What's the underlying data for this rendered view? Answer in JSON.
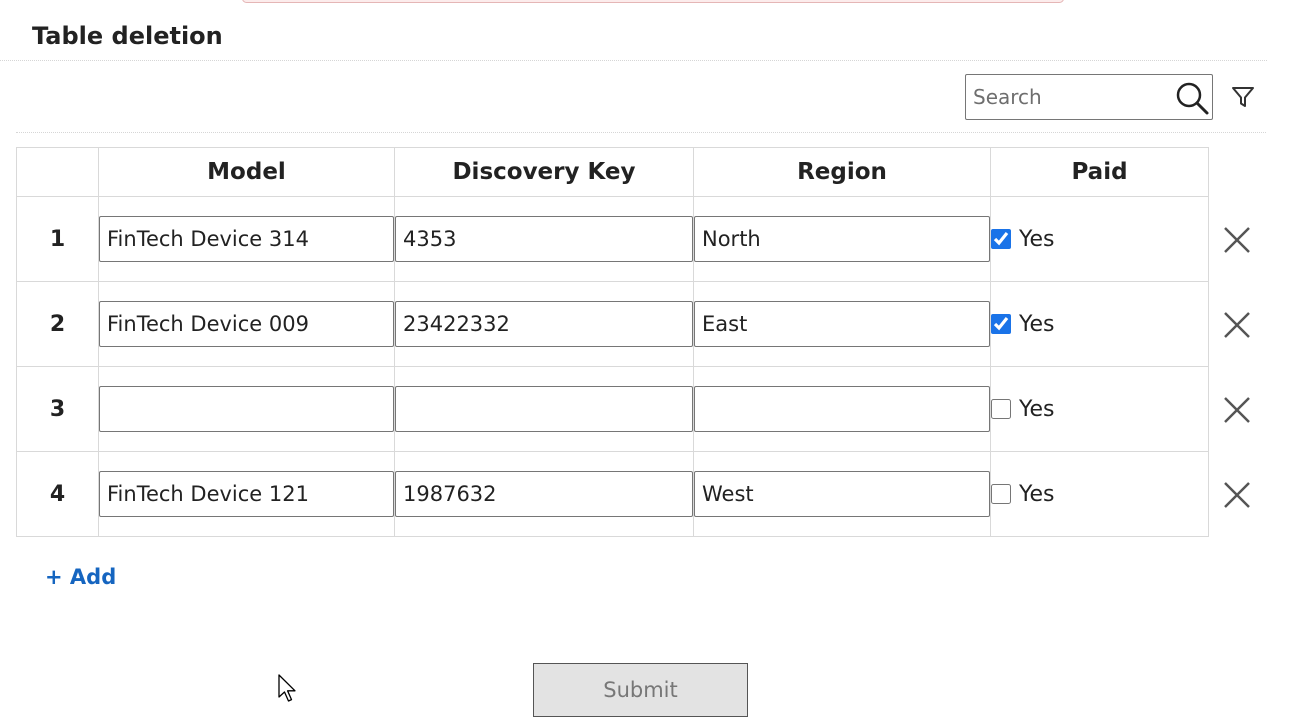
{
  "page": {
    "title": "Table deletion"
  },
  "toolbar": {
    "search_placeholder": "Search",
    "search_value": ""
  },
  "table": {
    "columns": [
      "",
      "Model",
      "Discovery Key",
      "Region",
      "Paid"
    ],
    "rows": [
      {
        "num": "1",
        "model": "FinTech Device 314",
        "key": "4353",
        "region": "North",
        "paid": true,
        "paid_label": "Yes"
      },
      {
        "num": "2",
        "model": "FinTech Device 009",
        "key": "23422332",
        "region": "East",
        "paid": true,
        "paid_label": "Yes"
      },
      {
        "num": "3",
        "model": "",
        "key": "",
        "region": "",
        "paid": false,
        "paid_label": "Yes"
      },
      {
        "num": "4",
        "model": "FinTech Device 121",
        "key": "1987632",
        "region": "West",
        "paid": false,
        "paid_label": "Yes"
      }
    ]
  },
  "actions": {
    "add_label": "+ Add",
    "submit_label": "Submit"
  },
  "icons": {
    "search": "search-icon",
    "filter": "filter-icon",
    "delete": "close-icon",
    "cursor": "mouse-pointer-icon"
  },
  "colors": {
    "accent": "#1a73e8",
    "link": "#1565c0",
    "submit_bg": "#e3e3e3"
  }
}
